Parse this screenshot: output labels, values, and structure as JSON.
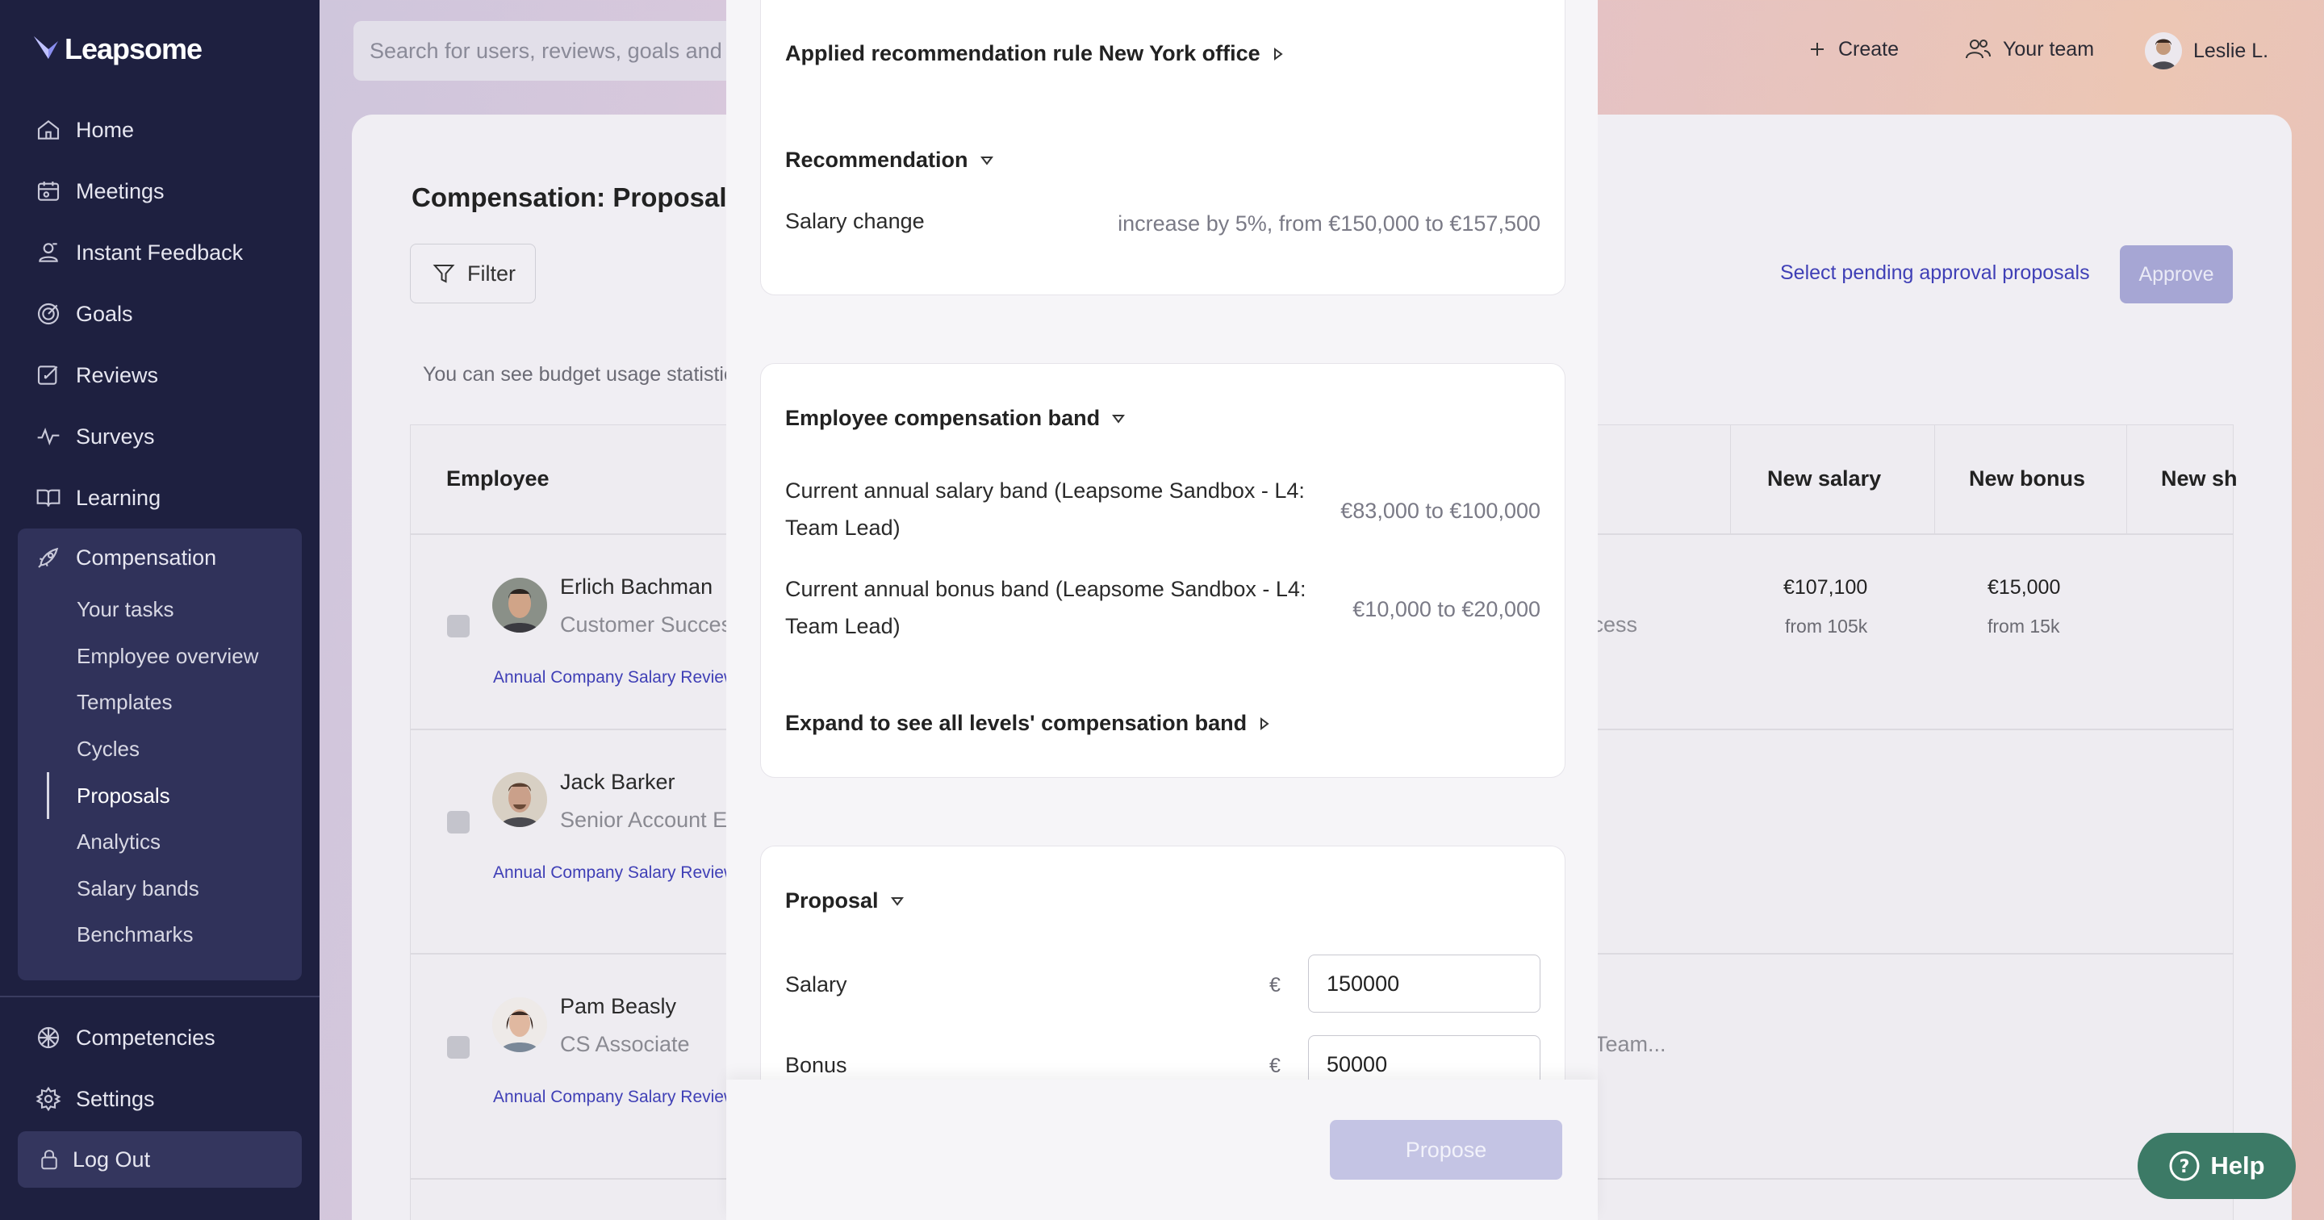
{
  "app": {
    "name": "Leapsome"
  },
  "sidebar": {
    "items": [
      {
        "label": "Home",
        "icon": "home-icon"
      },
      {
        "label": "Meetings",
        "icon": "meetings-icon"
      },
      {
        "label": "Instant Feedback",
        "icon": "feedback-icon"
      },
      {
        "label": "Goals",
        "icon": "goals-icon"
      },
      {
        "label": "Reviews",
        "icon": "reviews-icon"
      },
      {
        "label": "Surveys",
        "icon": "surveys-icon"
      },
      {
        "label": "Learning",
        "icon": "learning-icon"
      },
      {
        "label": "Compensation",
        "icon": "rocket-icon"
      }
    ],
    "compensation_sub": [
      "Your tasks",
      "Employee overview",
      "Templates",
      "Cycles",
      "Proposals",
      "Analytics",
      "Salary bands",
      "Benchmarks"
    ],
    "active_sub": "Proposals",
    "bottom_items": [
      {
        "label": "Competencies",
        "icon": "competencies-icon"
      },
      {
        "label": "Settings",
        "icon": "gear-icon"
      }
    ],
    "logout_label": "Log Out"
  },
  "topbar": {
    "search_placeholder": "Search for users, reviews, goals and m",
    "create_label": "Create",
    "team_label": "Your team",
    "user_label": "Leslie L."
  },
  "page": {
    "title": "Compensation: Proposals",
    "filter_label": "Filter",
    "select_pending_label": "Select pending approval proposals",
    "approve_label": "Approve",
    "budget_text": "You can see budget usage statistics"
  },
  "table": {
    "headers": {
      "employee": "Employee",
      "new_salary": "New salary",
      "new_bonus": "New bonus",
      "new_shares": "New sh"
    },
    "rows": [
      {
        "name": "Erlich Bachman",
        "role": "Customer Success",
        "cycle": "Annual Company Salary Review",
        "behind": "ccess",
        "new_salary": "€107,100",
        "salary_from": "from 105k",
        "new_bonus": "€15,000",
        "bonus_from": "from 15k"
      },
      {
        "name": "Jack Barker",
        "role": "Senior Account Executive",
        "cycle": "Annual Company Salary Review",
        "behind": "",
        "new_salary": "",
        "salary_from": "",
        "new_bonus": "",
        "bonus_from": ""
      },
      {
        "name": "Pam Beasly",
        "role": "CS Associate",
        "cycle": "Annual Company Salary Review",
        "behind": "Team...",
        "new_salary": "",
        "salary_from": "",
        "new_bonus": "",
        "bonus_from": ""
      }
    ]
  },
  "modal": {
    "rule_label": "Applied recommendation rule New York office",
    "recommendation_label": "Recommendation",
    "salary_change_label": "Salary change",
    "salary_change_value": "increase by 5%, from €150,000 to €157,500",
    "band_label": "Employee compensation band",
    "salary_band_label": "Current annual salary band (Leapsome Sandbox - L4: Team Lead)",
    "salary_band_value": "€83,000 to €100,000",
    "bonus_band_label": "Current annual bonus band (Leapsome Sandbox - L4: Team Lead)",
    "bonus_band_value": "€10,000 to €20,000",
    "expand_label": "Expand to see all levels' compensation band",
    "proposal_label": "Proposal",
    "salary_label": "Salary",
    "bonus_label": "Bonus",
    "currency": "€",
    "salary_value": "150000",
    "bonus_value": "50000",
    "propose_label": "Propose"
  },
  "help": {
    "label": "Help"
  }
}
